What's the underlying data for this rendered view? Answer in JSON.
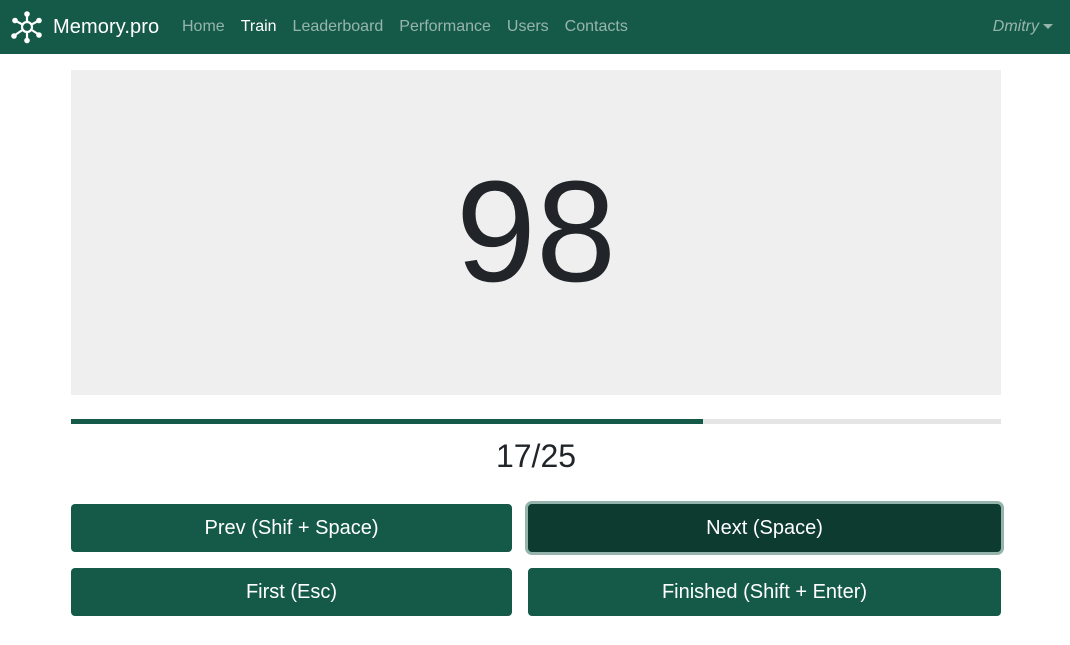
{
  "navbar": {
    "brand": "Memory.pro",
    "brand_icon": "molecule-network-icon",
    "links": [
      {
        "label": "Home",
        "active": false
      },
      {
        "label": "Train",
        "active": true
      },
      {
        "label": "Leaderboard",
        "active": false
      },
      {
        "label": "Performance",
        "active": false
      },
      {
        "label": "Users",
        "active": false
      },
      {
        "label": "Contacts",
        "active": false
      }
    ],
    "user": "Dmitry"
  },
  "trainer": {
    "current_card": "98",
    "progress_text": "17/25",
    "progress_fraction": 0.68
  },
  "buttons": {
    "prev": "Prev (Shif + Space)",
    "next": "Next (Space)",
    "first": "First (Esc)",
    "finished": "Finished (Shift + Enter)"
  },
  "colors": {
    "primary": "#155a48",
    "primary_active": "#0e3b2f",
    "card_background": "#efefef",
    "progress_track": "#e5e5e5"
  }
}
